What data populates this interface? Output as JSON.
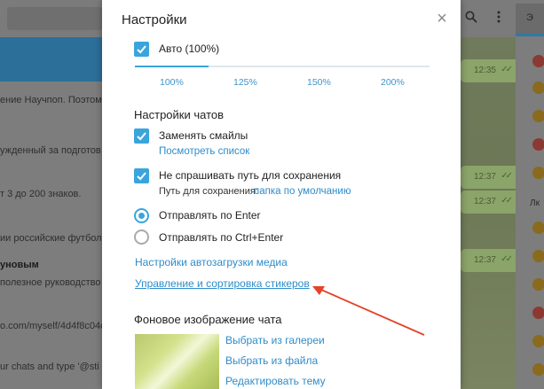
{
  "dialog": {
    "title": "Настройки",
    "close_glyph": "×",
    "auto_scale_label": "Авто (100%)",
    "scale_options": [
      "100%",
      "125%",
      "150%",
      "200%"
    ],
    "chats_section_title": "Настройки чатов",
    "replace_emoji_label": "Заменять смайлы",
    "view_list_link": "Посмотреть список",
    "ask_path_label": "Не спрашивать путь для сохранения",
    "save_path_label": "Путь для сохранения:",
    "save_path_value": "папка по умолчанию",
    "send_enter_label": "Отправлять по Enter",
    "send_ctrl_enter_label": "Отправлять по Ctrl+Enter",
    "autoload_media_link": "Настройки автозагрузки медиа",
    "stickers_link": "Управление и сортировка стикеров",
    "background_section_title": "Фоновое изображение чата",
    "choose_gallery_link": "Выбрать из галереи",
    "choose_file_link": "Выбрать из файла",
    "edit_theme_link": "Редактировать тему"
  },
  "background": {
    "left_lines": [
      "ение Научпоп. Поэтому",
      "ужденный за подготов",
      "т 3 до 200 знаков.",
      "ии российские футболис",
      "уновым",
      "полезное руководство",
      "o.com/myself/4d4f8c04c6",
      "ur chats and type '@sti"
    ],
    "times": [
      "12:35",
      "12:37",
      "12:37",
      "12:37"
    ],
    "right_tab_label": "Э",
    "right_label": "Лк"
  },
  "colors": {
    "accent": "#3aa5dc",
    "link": "#2e8cc9",
    "annotation_arrow": "#e5432a"
  }
}
